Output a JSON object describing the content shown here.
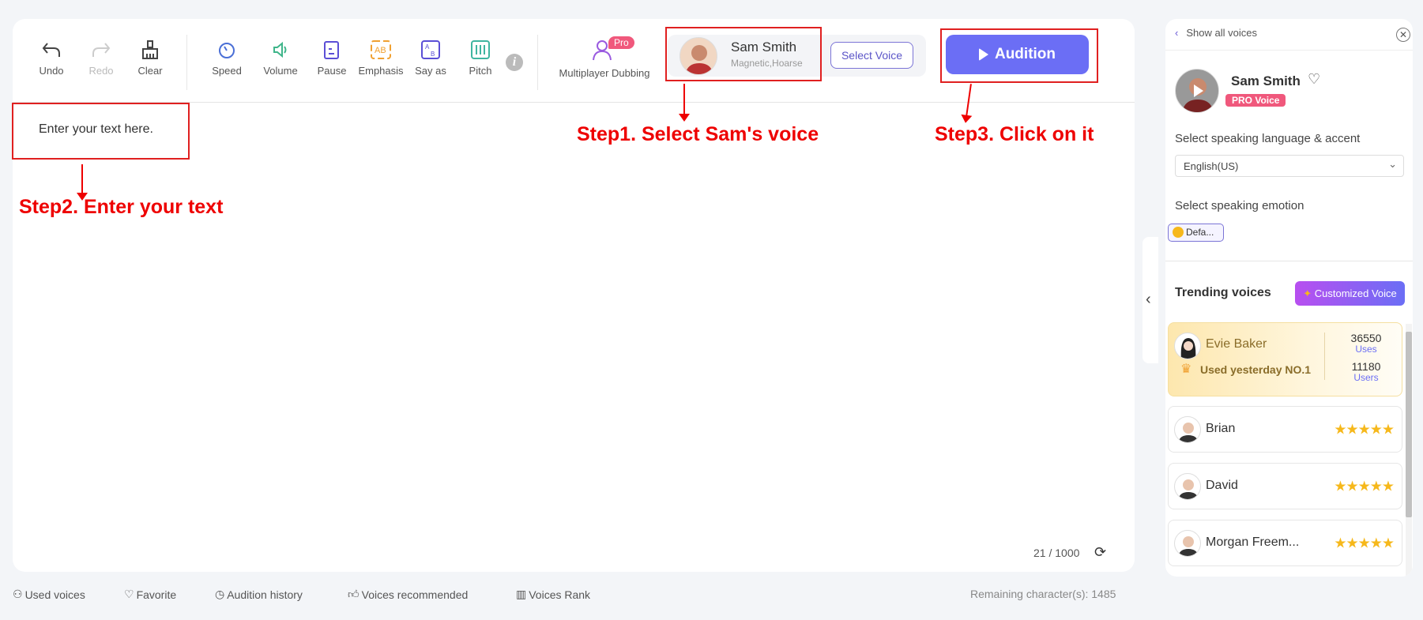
{
  "toolbar": {
    "items": [
      {
        "label": "Undo",
        "icon": "undo-icon"
      },
      {
        "label": "Redo",
        "icon": "redo-icon"
      },
      {
        "label": "Clear",
        "icon": "brush-icon"
      },
      {
        "label": "Speed",
        "icon": "speed-icon"
      },
      {
        "label": "Volume",
        "icon": "volume-icon"
      },
      {
        "label": "Pause",
        "icon": "pause-icon"
      },
      {
        "label": "Emphasis",
        "icon": "emphasis-icon"
      },
      {
        "label": "Say as",
        "icon": "say-as-icon"
      },
      {
        "label": "Pitch",
        "icon": "pitch-icon"
      }
    ],
    "multiplayer": "Multiplayer Dubbing",
    "pro": "Pro",
    "voice": {
      "name": "Sam Smith",
      "tags": "Magnetic,Hoarse",
      "select": "Select Voice"
    },
    "audition": "Audition"
  },
  "editor": {
    "text": "Enter your text here.",
    "count": "21",
    "max": "/ 1000"
  },
  "annotations": {
    "step1": "Step1. Select Sam's voice",
    "step2": "Step2. Enter your text",
    "step3": "Step3. Click on it"
  },
  "footer": {
    "items": [
      "Used voices",
      "Favorite",
      "Audition history",
      "Voices recommended",
      "Voices Rank"
    ],
    "remaining": "Remaining character(s): 1485"
  },
  "side": {
    "back": "Show all voices",
    "name": "Sam Smith",
    "badge": "PRO Voice",
    "lang_label": "Select speaking language & accent",
    "lang": "English(US)",
    "emotion_label": "Select speaking emotion",
    "emotion": "Defa...",
    "trending": "Trending voices",
    "custom": "Customized Voice",
    "top": {
      "name": "Evie Baker",
      "rank": "Used yesterday NO.1",
      "uses": "36550",
      "uses_label": "Uses",
      "users": "11180",
      "users_label": "Users"
    },
    "voices": [
      {
        "name": "Brian",
        "rating": 5
      },
      {
        "name": "David",
        "rating": 5
      },
      {
        "name": "Morgan Freem...",
        "rating": 5
      }
    ]
  },
  "colors": {
    "accent": "#6b6ef5",
    "annotation": "#e00000",
    "pro": "#f0587c"
  }
}
